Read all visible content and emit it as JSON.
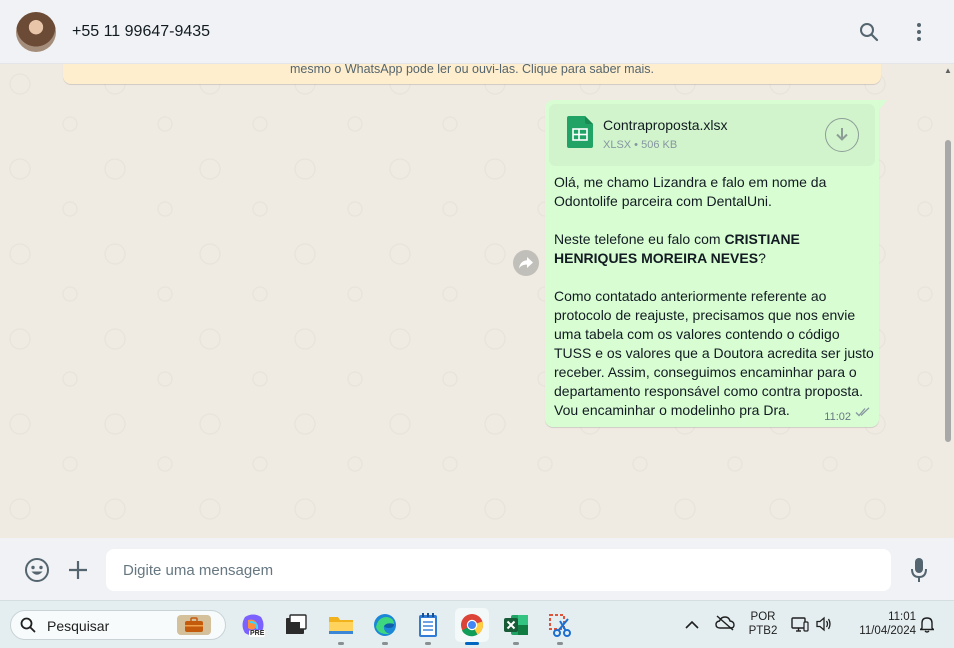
{
  "header": {
    "contact_name": "+55 11 99647-9435"
  },
  "chat": {
    "encryption_banner": "mesmo o WhatsApp pode ler ou ouvi-las. Clique para saber mais.",
    "message": {
      "file_name": "Contraproposta.xlsx",
      "file_meta": "XLSX • 506 KB",
      "p1": "Olá, me chamo Lizandra e falo em nome da Odontolife parceira com DentalUni.",
      "p2_pre": "Neste telefone eu falo com ",
      "p2_bold": "CRISTIANE HENRIQUES MOREIRA NEVES",
      "p2_post": "?",
      "p3": "Como contatado anteriormente referente ao protocolo de reajuste, precisamos que nos envie uma tabela com os valores contendo o código TUSS e os valores que a Doutora acredita ser justo receber. Assim, conseguimos encaminhar para o departamento responsável como contra proposta. Vou encaminhar o modelinho pra Dra.",
      "time": "11:02"
    }
  },
  "composer": {
    "placeholder": "Digite uma mensagem"
  },
  "taskbar": {
    "search_label": "Pesquisar",
    "copilot_badge": "PRE",
    "lang_line1": "POR",
    "lang_line2": "PTB2",
    "time": "11:01",
    "date": "11/04/2024"
  },
  "colors": {
    "bubble_out": "#d9fdd3",
    "chat_bg": "#efeae2",
    "header_bg": "#f0f2f5",
    "banner_bg": "#ffeecd",
    "excel_green": "#21a366"
  }
}
